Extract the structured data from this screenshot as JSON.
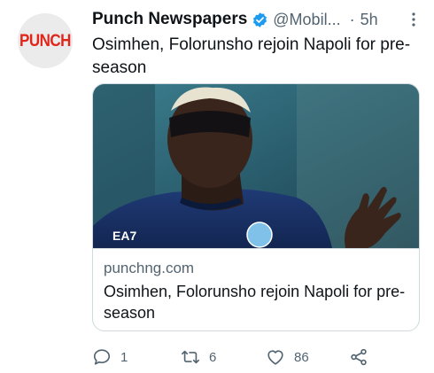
{
  "tweet": {
    "avatar_logo": "PUNCH",
    "display_name": "Punch Newspapers",
    "handle": "@Mobil...",
    "separator": "·",
    "timestamp": "5h",
    "text": "Osimhen, Folorunsho rejoin Napoli for pre-season"
  },
  "card": {
    "domain": "punchng.com",
    "title": "Osimhen, Folorunsho rejoin Napoli for pre-season",
    "image_jersey_text": "EA7"
  },
  "actions": {
    "reply_count": "1",
    "retweet_count": "6",
    "like_count": "86"
  },
  "colors": {
    "brand_red": "#e1251b",
    "verified_blue": "#1d9bf0",
    "secondary_text": "#536471",
    "border": "#cfd9de"
  },
  "icons": [
    "verified-badge-icon",
    "more-options-icon",
    "reply-icon",
    "retweet-icon",
    "like-icon",
    "share-icon"
  ]
}
